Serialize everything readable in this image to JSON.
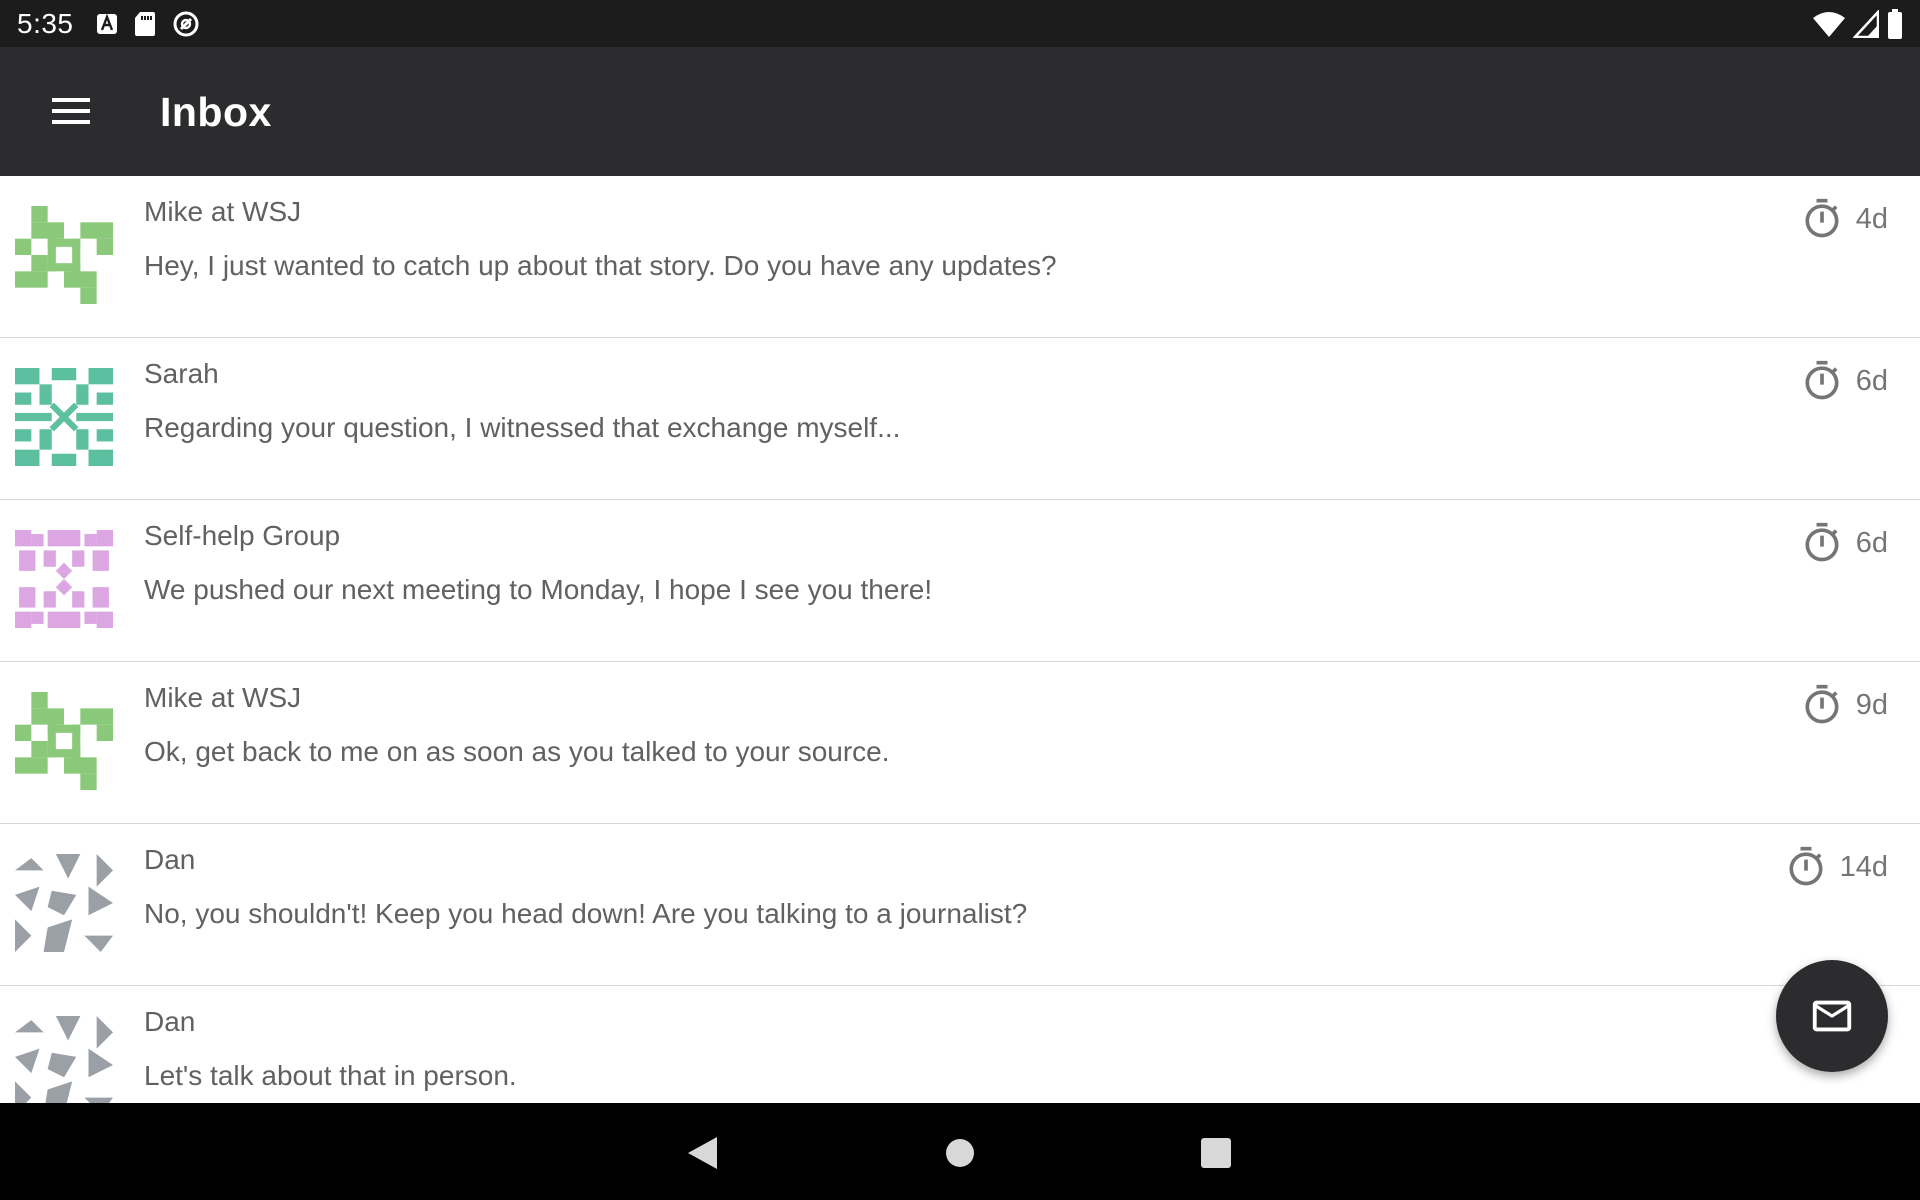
{
  "status_bar": {
    "time": "5:35",
    "left_icons": [
      "font-download-icon",
      "sd-card-icon",
      "do-not-disturb-icon"
    ],
    "right_icons": [
      "wifi-icon",
      "signal-icon",
      "battery-icon"
    ]
  },
  "app_bar": {
    "menu_icon": "hamburger-menu-icon",
    "title": "Inbox"
  },
  "messages": [
    {
      "sender": "Mike at WSJ",
      "preview": "Hey, I just wanted to catch up about that story. Do you have any updates?",
      "age": "4d",
      "avatar": "identicon-green-1",
      "avatar_color": "#8bc97a"
    },
    {
      "sender": "Sarah",
      "preview": "Regarding your question, I witnessed that exchange myself...",
      "age": "6d",
      "avatar": "identicon-teal",
      "avatar_color": "#5cbfa0"
    },
    {
      "sender": "Self-help Group",
      "preview": "We pushed our next meeting to Monday, I hope I see you there!",
      "age": "6d",
      "avatar": "identicon-pink",
      "avatar_color": "#dba6e1"
    },
    {
      "sender": "Mike at WSJ",
      "preview": "Ok, get back to me on as soon as you talked to your source.",
      "age": "9d",
      "avatar": "identicon-green-2",
      "avatar_color": "#8bc97a"
    },
    {
      "sender": "Dan",
      "preview": "No, you shouldn't! Keep you head down! Are you talking to a journalist?",
      "age": "14d",
      "avatar": "identicon-gray-1",
      "avatar_color": "#9aa0a6"
    },
    {
      "sender": "Dan",
      "preview": "Let's talk about that in person.",
      "age": "",
      "avatar": "identicon-gray-2",
      "avatar_color": "#9aa0a6"
    }
  ],
  "fab": {
    "icon": "mail-icon"
  },
  "nav_bar": {
    "icons": [
      "back-icon",
      "home-icon",
      "recents-icon"
    ]
  },
  "colors": {
    "status_bar": "#1c1c1c",
    "app_bar": "#2c2c2e",
    "text_secondary": "#616161",
    "divider": "#d9d9d9",
    "fab": "#2c2c2e"
  }
}
